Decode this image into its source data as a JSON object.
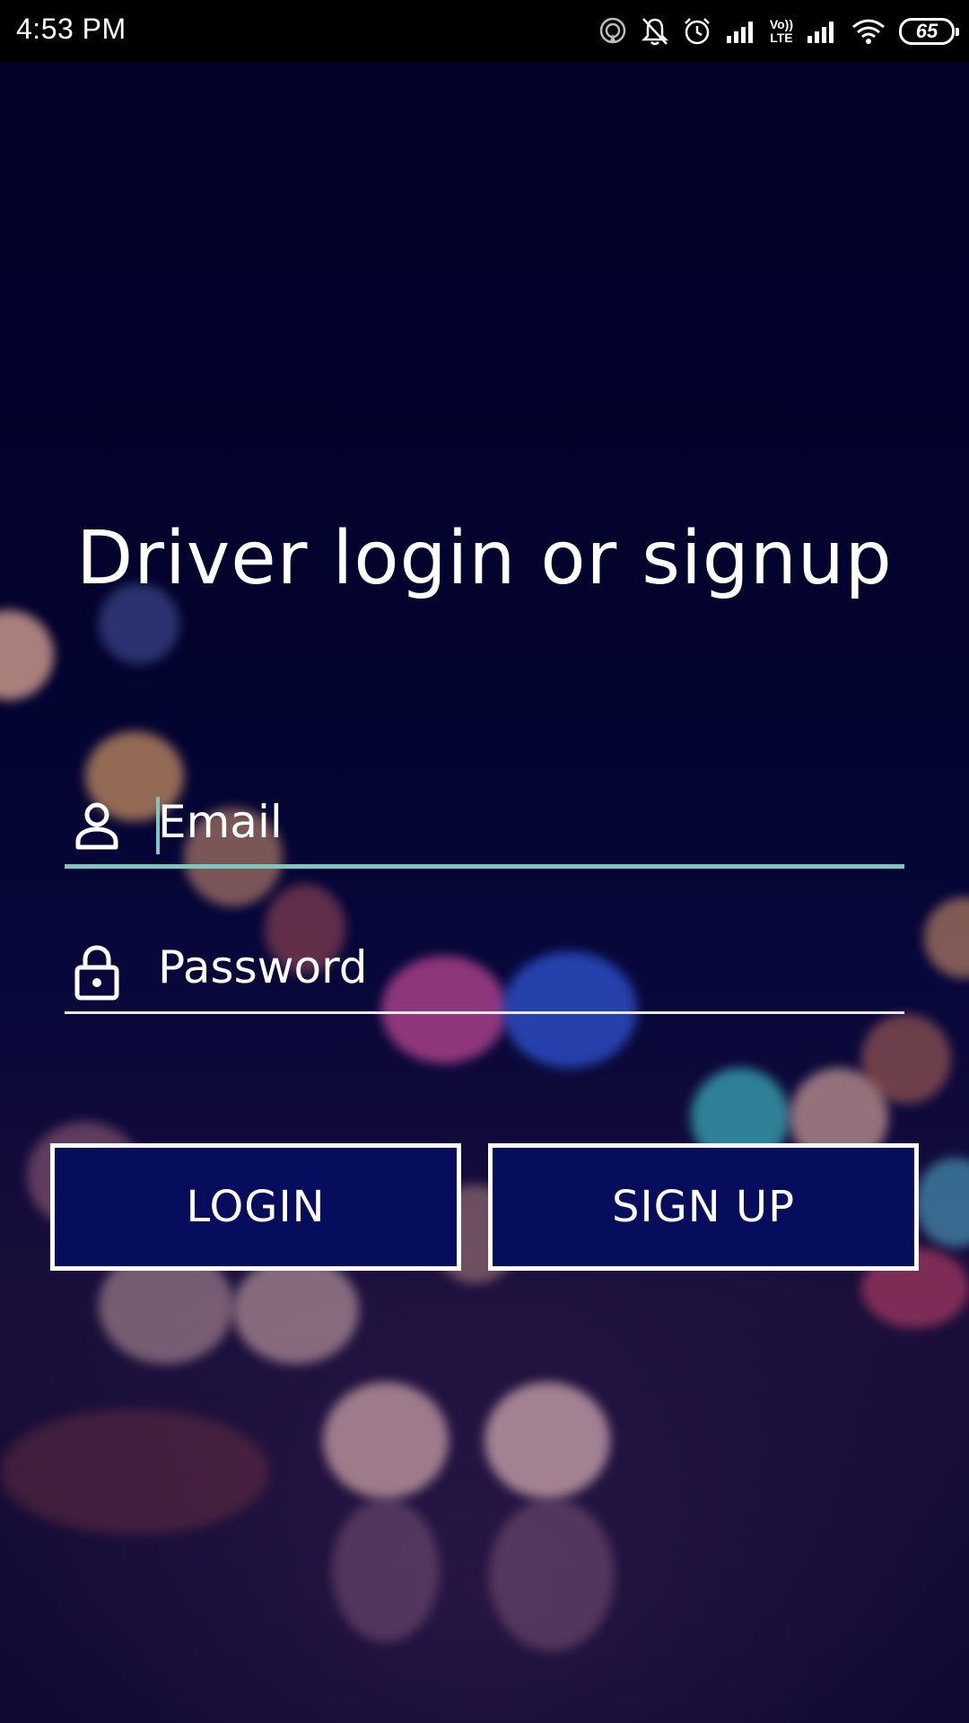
{
  "status_bar": {
    "time": "4:53 PM",
    "lte_top": "Vo))",
    "lte_bottom": "LTE",
    "battery": "65",
    "icons": [
      "hotspot-icon",
      "bell-off-icon",
      "alarm-icon",
      "signal-icon",
      "volte-icon",
      "signal-icon",
      "wifi-icon",
      "battery-icon"
    ]
  },
  "screen": {
    "title": "Driver login or signup"
  },
  "form": {
    "email_placeholder": "Email",
    "email_icon": "person-icon",
    "password_placeholder": "Password",
    "password_icon": "lock-icon"
  },
  "buttons": {
    "login_label": "LOGIN",
    "signup_label": "SIGN UP"
  },
  "colors": {
    "background": "#03032a",
    "accent_underline": "#7fc7bd",
    "button_fill": "#050d5c",
    "button_border": "#ffffff",
    "text": "#ffffff"
  }
}
